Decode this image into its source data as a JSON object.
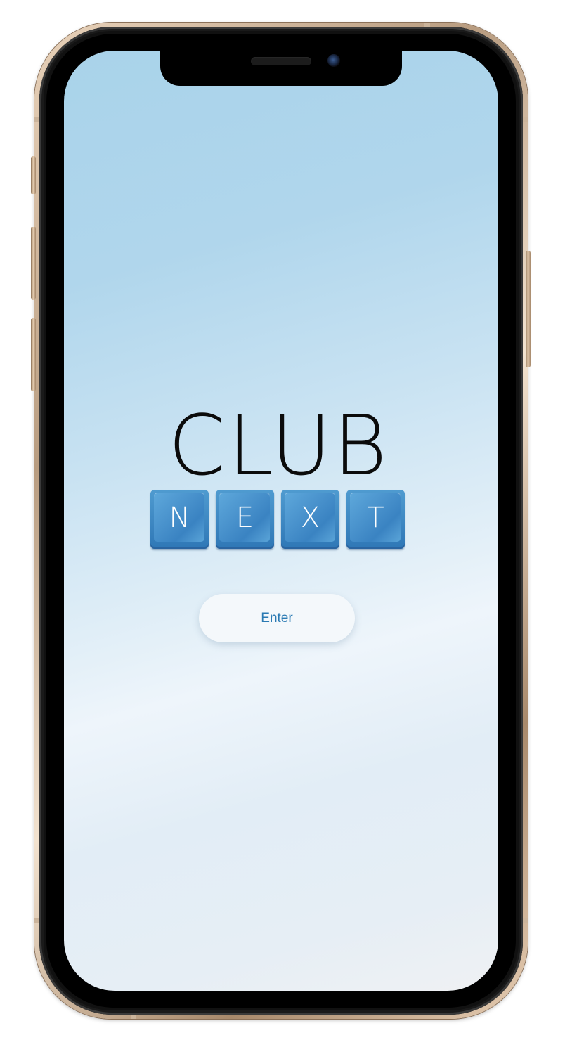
{
  "logo": {
    "word_top": "CLUB",
    "tiles": [
      "N",
      "E",
      "X",
      "T"
    ]
  },
  "enter_button": {
    "label": "Enter"
  },
  "colors": {
    "tile_blue": "#3f88c5",
    "button_text": "#2a7ab3",
    "background_top": "#a9d3ea",
    "background_bottom": "#eff1f3"
  },
  "icons": [
    "front-camera-icon",
    "earpiece-speaker-icon"
  ]
}
